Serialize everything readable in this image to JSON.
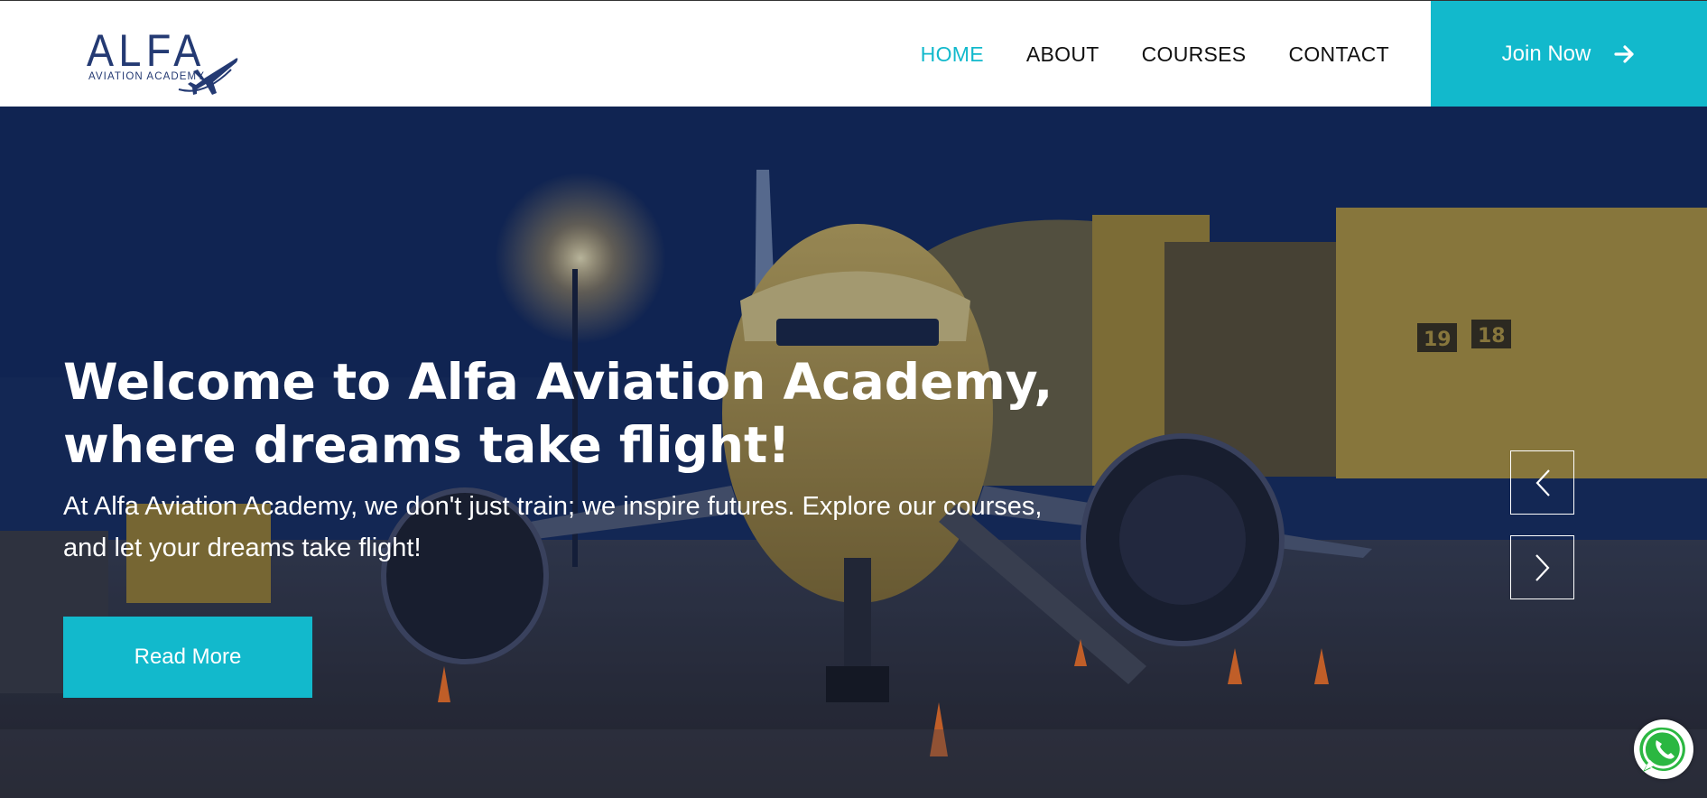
{
  "logo": {
    "brand": "ALFA",
    "tagline": "AVIATION ACADEMY",
    "icon": "airplane-icon"
  },
  "nav": {
    "items": [
      {
        "label": "HOME",
        "active": true
      },
      {
        "label": "ABOUT",
        "active": false
      },
      {
        "label": "COURSES",
        "active": false
      },
      {
        "label": "CONTACT",
        "active": false
      }
    ],
    "cta_label": "Join Now",
    "cta_icon": "arrow-right-icon"
  },
  "hero": {
    "title": "Welcome to Alfa Aviation Academy, where dreams take flight!",
    "subtitle": "At Alfa Aviation Academy, we don't just train; we inspire futures. Explore our courses, and let your dreams take flight!",
    "button_label": "Read More",
    "prev_icon": "chevron-left-icon",
    "next_icon": "chevron-right-icon",
    "background": "airport-apron-night-photo",
    "gate_numbers": [
      "19",
      "18"
    ]
  },
  "floating": {
    "whatsapp_icon": "whatsapp-icon"
  },
  "colors": {
    "accent": "#12b9cc",
    "brand_navy": "#243a73",
    "nav_text": "#111111",
    "hero_text": "#ffffff"
  }
}
